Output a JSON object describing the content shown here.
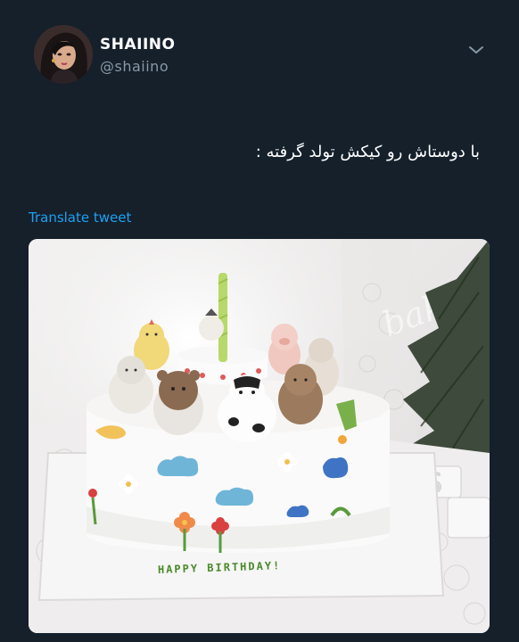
{
  "user": {
    "display_name": "SHAIINO",
    "handle": "@shaiino"
  },
  "tweet": {
    "text": "با دوستاش رو کیکش تولد گرفته :",
    "translate_label": "Translate tweet"
  },
  "media": {
    "cake_text": "HAPPY BIRTHDAY!",
    "watermark": "bakery"
  },
  "icons": {
    "menu": "chevron-down-icon"
  },
  "colors": {
    "background": "#15202b",
    "text_primary": "#ffffff",
    "text_secondary": "#8899a6",
    "link": "#1da1f2"
  }
}
